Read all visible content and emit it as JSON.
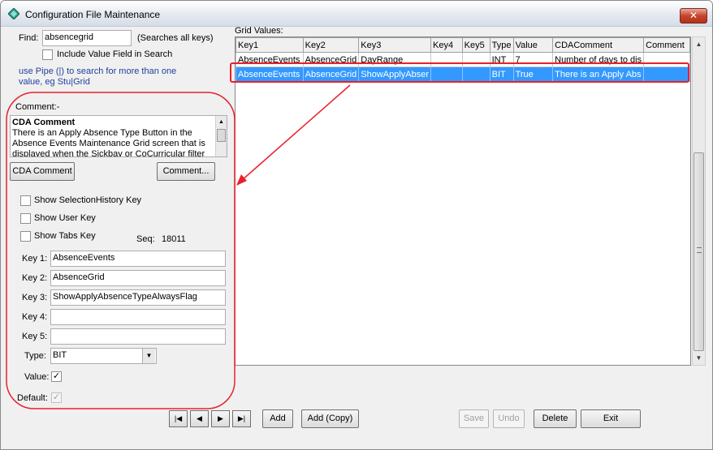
{
  "window": {
    "title": "Configuration File Maintenance",
    "close_label": "✕"
  },
  "search": {
    "find_label": "Find:",
    "value": "absencegrid",
    "hint": "(Searches all keys)",
    "include_value_label": "Include Value Field  in Search",
    "pipe_hint": "use Pipe (|) to search for more than one value, eg Stu|Grid"
  },
  "comment": {
    "section_label": "Comment:-",
    "heading": "CDA Comment",
    "text": "There is an Apply Absence Type Button in the Absence Events Maintenance Grid screen that is displayed when the Sickbay or CoCurricular filter is",
    "cda_button": "CDA Comment",
    "comment_button": "Comment..."
  },
  "options": {
    "show_selection_history": "Show SelectionHistory Key",
    "show_user_key": "Show User Key",
    "show_tabs_key": "Show Tabs Key",
    "seq_label": "Seq:",
    "seq_value": "18011"
  },
  "keys": {
    "key1_label": "Key 1:",
    "key1_value": "AbsenceEvents",
    "key2_label": "Key 2:",
    "key2_value": "AbsenceGrid",
    "key3_label": "Key 3:",
    "key3_value": "ShowApplyAbsenceTypeAlwaysFlag",
    "key4_label": "Key 4:",
    "key4_value": "",
    "key5_label": "Key 5:",
    "key5_value": "",
    "type_label": "Type:",
    "type_value": "BIT",
    "value_label": "Value:",
    "value_checked": "✓",
    "default_label": "Default:",
    "default_checked": "✓"
  },
  "grid": {
    "label": "Grid Values:",
    "columns": [
      "Key1",
      "Key2",
      "Key3",
      "Key4",
      "Key5",
      "Type",
      "Value",
      "CDAComment",
      "Comment"
    ],
    "rows": [
      [
        "AbsenceEvents",
        "AbsenceGrid",
        "DayRange",
        "",
        "",
        "INT",
        "7",
        "Number of days to dis",
        ""
      ],
      [
        "AbsenceEvents",
        "AbsenceGrid",
        "ShowApplyAbser",
        "",
        "",
        "BIT",
        "True",
        "There is an Apply Abs",
        ""
      ]
    ]
  },
  "footer": {
    "first": "|◀",
    "prev": "◀",
    "next": "▶",
    "last": "▶|",
    "add": "Add",
    "add_copy": "Add (Copy)",
    "save": "Save",
    "undo": "Undo",
    "delete": "Delete",
    "exit": "Exit"
  },
  "colors": {
    "annotation": "#e8202a",
    "selection": "#3399ff"
  }
}
